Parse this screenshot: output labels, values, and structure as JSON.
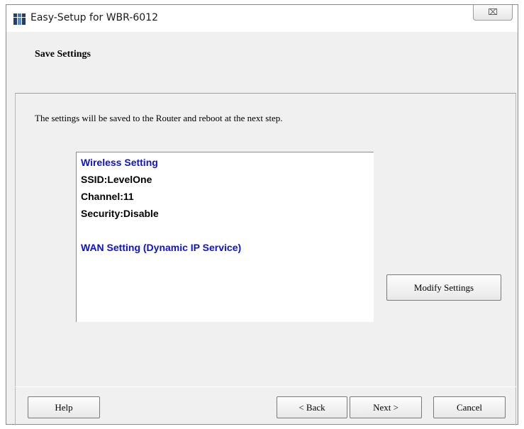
{
  "window": {
    "title": "Easy-Setup for WBR-6012",
    "close_glyph": "⌧"
  },
  "header": {
    "title": "Save Settings"
  },
  "main": {
    "description": "The settings will be saved to the Router and reboot at the next step.",
    "summary": {
      "wireless_heading": "Wireless Setting",
      "ssid": "SSID:LevelOne",
      "channel": "Channel:11",
      "security": "Security:Disable",
      "wan_heading": "WAN Setting  (Dynamic IP Service)"
    },
    "modify_label": "Modify Settings"
  },
  "footer": {
    "help_label": "Help",
    "back_label": "< Back",
    "next_label": "Next >",
    "cancel_label": "Cancel"
  },
  "colors": {
    "heading_blue": "#0b12d6",
    "window_bg": "#f0f0f0",
    "icon_main": "#1f3c73",
    "icon_accent": "#2f78d8"
  },
  "icons": {
    "app": "levelone-app-icon",
    "close": "close-icon"
  }
}
